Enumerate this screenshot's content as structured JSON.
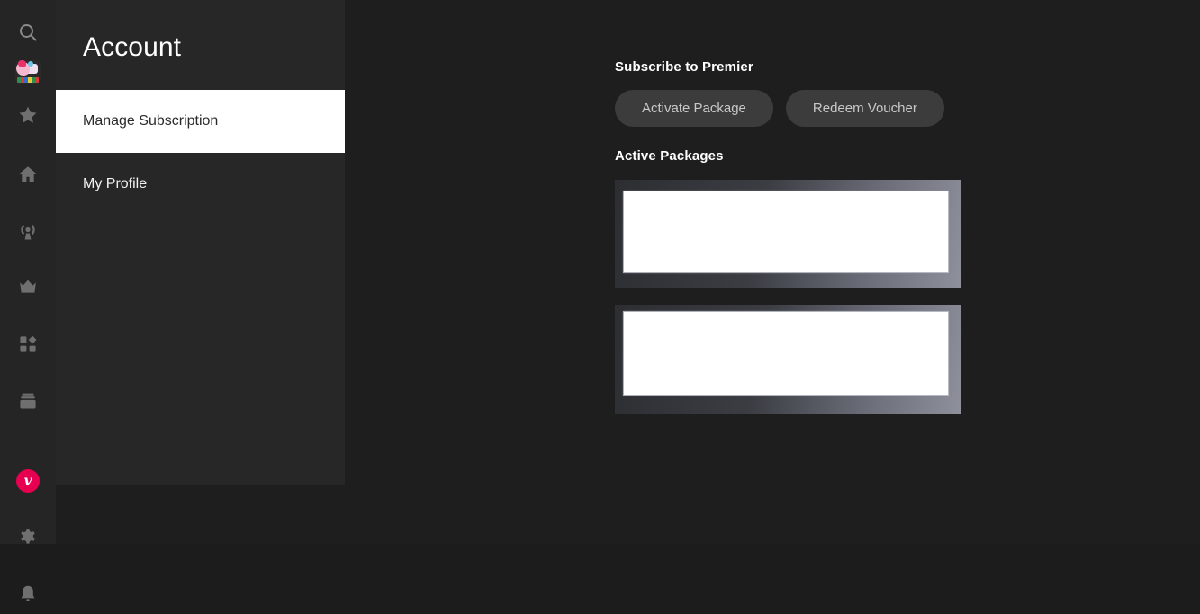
{
  "app": {
    "background_color": "#1e1e1e",
    "panel_color": "#272727",
    "rail_color": "#252525",
    "brand_color": "#e6004f",
    "accent_text_color": "#c9c9c9"
  },
  "icon_rail": {
    "items": [
      {
        "name": "search-icon",
        "label": "Search"
      },
      {
        "name": "profile-avatar",
        "label": "Profile"
      },
      {
        "name": "star-icon",
        "label": "Favourites"
      },
      {
        "name": "home-icon",
        "label": "Home"
      },
      {
        "name": "broadcast-icon",
        "label": "Live"
      },
      {
        "name": "crown-icon",
        "label": "Premium"
      },
      {
        "name": "apps-grid-icon",
        "label": "Categories"
      },
      {
        "name": "box-stack-icon",
        "label": "Library"
      },
      {
        "name": "viu-brand-icon",
        "label": "Viu"
      },
      {
        "name": "gear-icon",
        "label": "Settings"
      },
      {
        "name": "bell-icon",
        "label": "Notifications"
      }
    ],
    "avatar_strip_colors": [
      "#2f8f4b",
      "#d93b3b",
      "#2f6fd0",
      "#e8c93a",
      "#2f8f4b",
      "#d93b3b"
    ]
  },
  "sidebar": {
    "title": "Account",
    "items": [
      {
        "label": "Manage Subscription",
        "active": true
      },
      {
        "label": "My Profile",
        "active": false
      }
    ]
  },
  "main": {
    "subscribe_heading": "Subscribe to Premier",
    "buttons": [
      {
        "label": "Activate Package",
        "name": "activate-package-button"
      },
      {
        "label": "Redeem Voucher",
        "name": "redeem-voucher-button"
      }
    ],
    "active_packages_heading": "Active Packages",
    "packages": [
      {
        "state": "loading-placeholder"
      },
      {
        "state": "loading-placeholder"
      }
    ]
  }
}
